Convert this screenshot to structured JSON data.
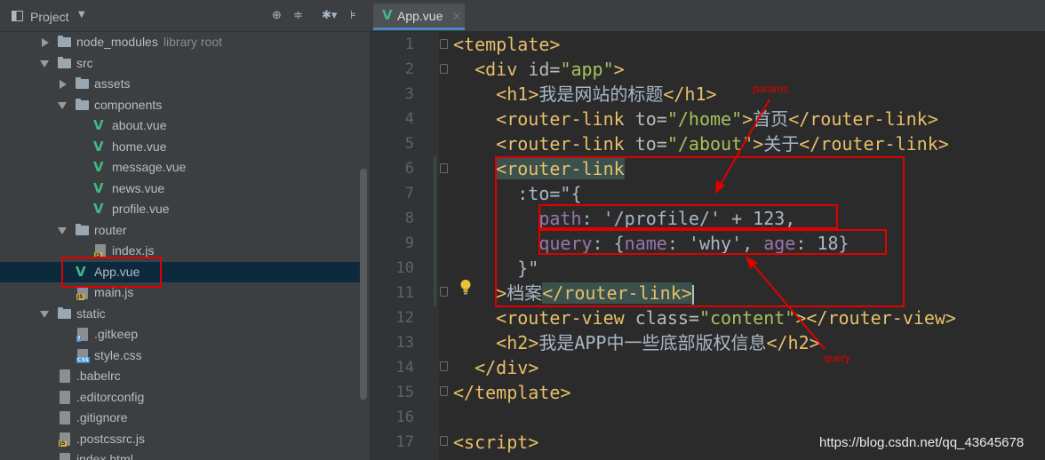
{
  "sidebar": {
    "title": "Project",
    "toolbar_icons": [
      "crosshair-icon",
      "collapse-icon",
      "gear-icon",
      "hide-icon"
    ],
    "tree": [
      {
        "name": "node_modules",
        "note": "library root",
        "kind": "folder",
        "state": "collapsed",
        "depth": 0
      },
      {
        "name": "src",
        "kind": "folder",
        "state": "expanded",
        "depth": 0
      },
      {
        "name": "assets",
        "kind": "folder",
        "state": "collapsed",
        "depth": 1
      },
      {
        "name": "components",
        "kind": "folder",
        "state": "expanded",
        "depth": 1
      },
      {
        "name": "about.vue",
        "kind": "vue",
        "depth": 2
      },
      {
        "name": "home.vue",
        "kind": "vue",
        "depth": 2
      },
      {
        "name": "message.vue",
        "kind": "vue",
        "depth": 2
      },
      {
        "name": "news.vue",
        "kind": "vue",
        "depth": 2
      },
      {
        "name": "profile.vue",
        "kind": "vue",
        "depth": 2
      },
      {
        "name": "router",
        "kind": "folder",
        "state": "expanded",
        "depth": 1
      },
      {
        "name": "index.js",
        "kind": "js",
        "depth": 2
      },
      {
        "name": "App.vue",
        "kind": "vue",
        "depth": 1,
        "selected": true
      },
      {
        "name": "main.js",
        "kind": "js",
        "depth": 1
      },
      {
        "name": "static",
        "kind": "folder",
        "state": "expanded",
        "depth": 0
      },
      {
        "name": ".gitkeep",
        "kind": "q",
        "depth": 1
      },
      {
        "name": "style.css",
        "kind": "css",
        "depth": 1
      },
      {
        "name": ".babelrc",
        "kind": "config",
        "depth": 0
      },
      {
        "name": ".editorconfig",
        "kind": "config",
        "depth": 0
      },
      {
        "name": ".gitignore",
        "kind": "config",
        "depth": 0
      },
      {
        "name": ".postcssrc.js",
        "kind": "js",
        "depth": 0
      },
      {
        "name": "index.html",
        "kind": "config",
        "depth": 0
      }
    ]
  },
  "editor": {
    "tab": {
      "label": "App.vue",
      "close": "×"
    },
    "line_numbers": [
      "1",
      "2",
      "3",
      "4",
      "5",
      "6",
      "7",
      "8",
      "9",
      "10",
      "11",
      "12",
      "13",
      "14",
      "15",
      "16",
      "17"
    ],
    "lines": [
      [
        {
          "c": "tg",
          "t": "<template>"
        }
      ],
      [
        {
          "c": "tx",
          "t": "  "
        },
        {
          "c": "tg",
          "t": "<div "
        },
        {
          "c": "at",
          "t": "id="
        },
        {
          "c": "av",
          "t": "\"app\""
        },
        {
          "c": "tg",
          "t": ">"
        }
      ],
      [
        {
          "c": "tx",
          "t": "    "
        },
        {
          "c": "tg",
          "t": "<h1>"
        },
        {
          "c": "tx",
          "t": "我是网站的标题"
        },
        {
          "c": "tg",
          "t": "</h1>"
        }
      ],
      [
        {
          "c": "tx",
          "t": "    "
        },
        {
          "c": "tg",
          "t": "<router-link "
        },
        {
          "c": "at",
          "t": "to="
        },
        {
          "c": "av",
          "t": "\"/home\""
        },
        {
          "c": "tg",
          "t": ">"
        },
        {
          "c": "tx",
          "t": "首页"
        },
        {
          "c": "tg",
          "t": "</router-link>"
        }
      ],
      [
        {
          "c": "tx",
          "t": "    "
        },
        {
          "c": "tg",
          "t": "<router-link "
        },
        {
          "c": "at",
          "t": "to="
        },
        {
          "c": "av",
          "t": "\"/about\""
        },
        {
          "c": "tg",
          "t": ">"
        },
        {
          "c": "tx",
          "t": "关于"
        },
        {
          "c": "tg",
          "t": "</router-link>"
        }
      ],
      [
        {
          "c": "tx",
          "t": "    "
        },
        {
          "c": "tg hl",
          "t": "<router-link"
        }
      ],
      [
        {
          "c": "tx",
          "t": "      :to=\"{"
        }
      ],
      [
        {
          "c": "tx",
          "t": "        "
        },
        {
          "c": "pr",
          "t": "path"
        },
        {
          "c": "tx",
          "t": ": '/profile/' + 123,"
        }
      ],
      [
        {
          "c": "tx",
          "t": "        "
        },
        {
          "c": "pr",
          "t": "query"
        },
        {
          "c": "tx",
          "t": ": {"
        },
        {
          "c": "pr",
          "t": "name"
        },
        {
          "c": "tx",
          "t": ": 'why', "
        },
        {
          "c": "pr",
          "t": "age"
        },
        {
          "c": "tx",
          "t": ": 18}"
        }
      ],
      [
        {
          "c": "tx",
          "t": "      }\""
        }
      ],
      [
        {
          "c": "tx",
          "t": "    "
        },
        {
          "c": "tg",
          "t": ">"
        },
        {
          "c": "tx",
          "t": "档案"
        },
        {
          "c": "tg hl",
          "t": "</router-link>"
        }
      ],
      [
        {
          "c": "tx",
          "t": "    "
        },
        {
          "c": "tg",
          "t": "<router-view "
        },
        {
          "c": "at",
          "t": "class="
        },
        {
          "c": "av",
          "t": "\"content\""
        },
        {
          "c": "tg",
          "t": "></router-view>"
        }
      ],
      [
        {
          "c": "tx",
          "t": "    "
        },
        {
          "c": "tg",
          "t": "<h2>"
        },
        {
          "c": "tx",
          "t": "我是APP中一些底部版权信息"
        },
        {
          "c": "tg",
          "t": "</h2>"
        }
      ],
      [
        {
          "c": "tx",
          "t": "  "
        },
        {
          "c": "tg",
          "t": "</div>"
        }
      ],
      [
        {
          "c": "tg",
          "t": "</template>"
        }
      ],
      [],
      [
        {
          "c": "tg",
          "t": "<script>"
        }
      ]
    ]
  },
  "annotations": {
    "params_label": "params",
    "query_label": "query",
    "color": "#e00000"
  },
  "watermark": "https://blog.csdn.net/qq_43645678",
  "colors": {
    "tag": "#e8bf6a",
    "attr_value": "#a5c25c",
    "property": "#9876aa",
    "vue": "#41b883",
    "selection": "#0d293e"
  }
}
